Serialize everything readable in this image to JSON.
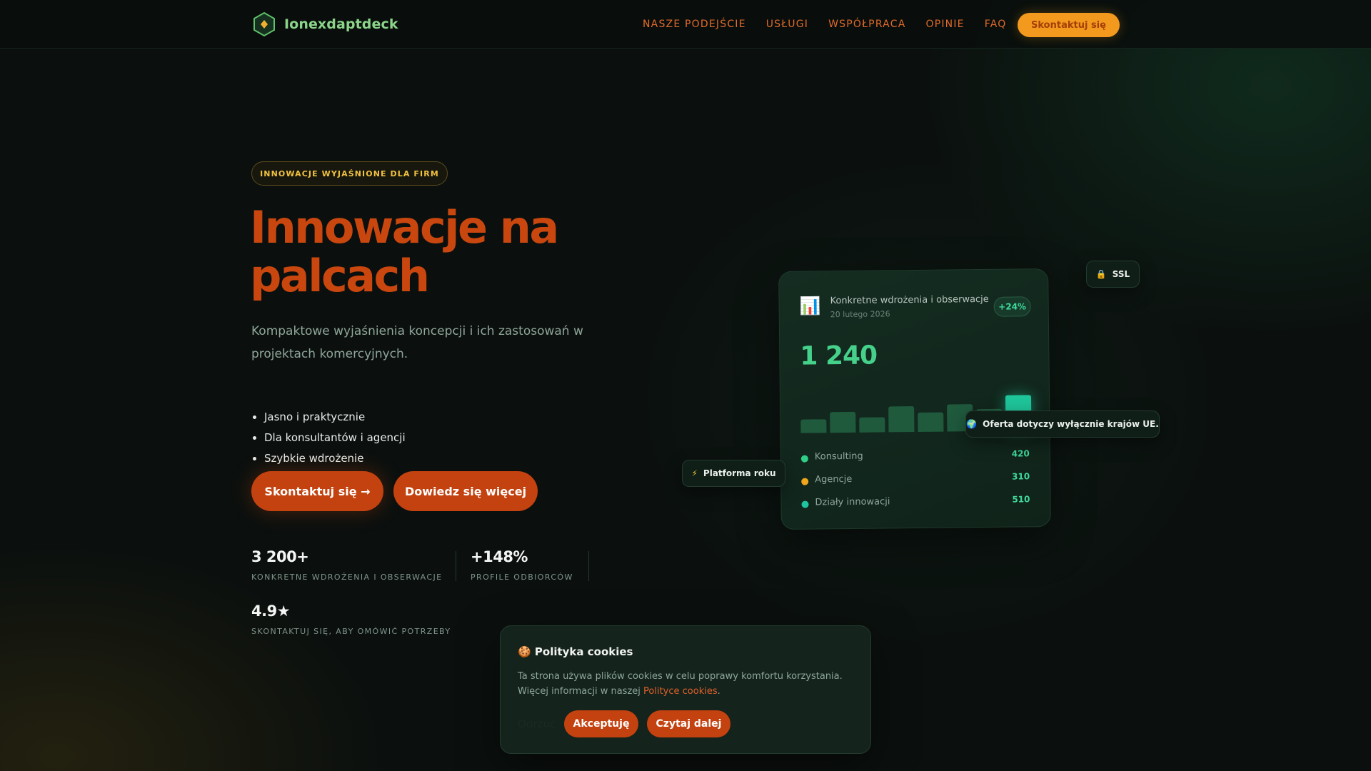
{
  "brand": {
    "name": "Ionexdaptdeck",
    "logo_icon": "hexagon-logo-icon"
  },
  "nav": {
    "items": [
      "NASZE PODEJŚCIE",
      "USŁUGI",
      "WSPÓŁPRACA",
      "OPINIE",
      "FAQ"
    ],
    "cta": "Skontaktuj się"
  },
  "hero": {
    "badge": "INNOWACJE WYJAŚNIONE DLA FIRM",
    "title": "Innowacje na palcach",
    "subtitle": "Kompaktowe wyjaśnienia koncepcji i ich zastosowań w projektach komercyjnych.",
    "bullets": [
      "Jasno i praktycznie",
      "Dla konsultantów i agencji",
      "Szybkie wdrożenie"
    ],
    "primary_button": "Skontaktuj się →",
    "secondary_button": "Dowiedz się więcej"
  },
  "stats": [
    {
      "value": "3 200+",
      "label": "KONKRETNE WDROŻENIA I OBSERWACJE"
    },
    {
      "value": "+148%",
      "label": "PROFILE ODBIORCÓW"
    },
    {
      "value": "4.9★",
      "label": "SKONTAKTUJ SIĘ, ABY OMÓWIĆ POTRZEBY"
    }
  ],
  "dashboard": {
    "icon": "bar-chart-icon",
    "title": "Konkretne wdrożenia i obserwacje",
    "date": "20 lutego 2026",
    "change": "+24%",
    "total": "1 240",
    "bars": [
      0.34,
      0.52,
      0.38,
      0.64,
      0.48,
      0.68,
      0.55,
      0.9
    ],
    "legend": [
      {
        "label": "Konsulting",
        "value": "420",
        "color": "#2fcf86"
      },
      {
        "label": "Agencje",
        "value": "310",
        "color": "#f0a71c"
      },
      {
        "label": "Działy innowacji",
        "value": "510",
        "color": "#1fc5a0"
      }
    ]
  },
  "chips": {
    "ssl": {
      "icon": "lock-icon",
      "label": "SSL"
    },
    "eu": {
      "icon": "globe-icon",
      "label": "Oferta dotyczy wyłącznie krajów UE."
    },
    "platform": {
      "icon": "lightning-icon",
      "label": "Platforma roku"
    }
  },
  "cookie": {
    "title": "🍪 Polityka cookies",
    "text": "Ta strona używa plików cookies w celu poprawy komfortu korzystania. Więcej informacji w naszej",
    "link": "Polityce cookies",
    "text_end": ".",
    "reject": "Odrzuć",
    "accept": "Akceptuję",
    "more": "Czytaj dalej"
  },
  "colors": {
    "accent": "#c4420f",
    "cta_orange": "#f39a1e",
    "green": "#45d18a",
    "background": "#0b100e"
  }
}
